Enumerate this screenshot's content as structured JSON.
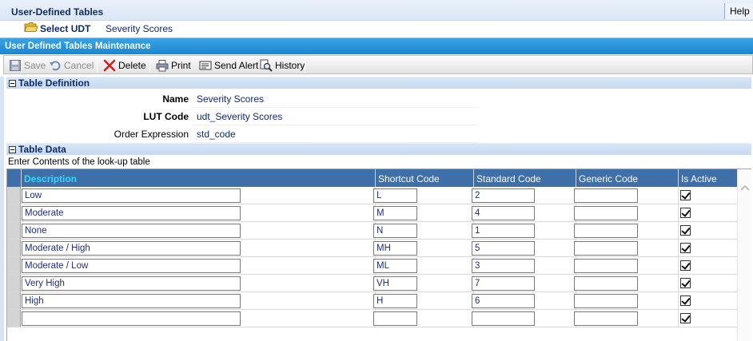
{
  "app": {
    "title": "User-Defined Tables",
    "help_label": "Help"
  },
  "select_bar": {
    "label": "Select UDT",
    "value": "Severity Scores"
  },
  "maintenance": {
    "title": "User Defined Tables Maintenance"
  },
  "toolbar": {
    "save": "Save",
    "cancel": "Cancel",
    "delete": "Delete",
    "print": "Print",
    "send_alert": "Send Alert",
    "history": "History"
  },
  "definition": {
    "section_title": "Table Definition",
    "name_label": "Name",
    "name_value": "Severity Scores",
    "lut_code_label": "LUT Code",
    "lut_code_value": "udt_Severity Scores",
    "order_expr_label": "Order Expression",
    "order_expr_value": "std_code"
  },
  "data": {
    "section_title": "Table Data",
    "instructions": "Enter Contents of the look-up table",
    "columns": [
      "Description",
      "Shortcut Code",
      "Standard Code",
      "Generic Code",
      "Is Active"
    ],
    "rows": [
      {
        "description": "Low",
        "shortcut": "L",
        "standard": "2",
        "generic": "",
        "active": true
      },
      {
        "description": "Moderate",
        "shortcut": "M",
        "standard": "4",
        "generic": "",
        "active": true
      },
      {
        "description": "None",
        "shortcut": "N",
        "standard": "1",
        "generic": "",
        "active": true
      },
      {
        "description": "Moderate / High",
        "shortcut": "MH",
        "standard": "5",
        "generic": "",
        "active": true
      },
      {
        "description": "Moderate / Low",
        "shortcut": "ML",
        "standard": "3",
        "generic": "",
        "active": true
      },
      {
        "description": "Very High",
        "shortcut": "VH",
        "standard": "7",
        "generic": "",
        "active": true
      },
      {
        "description": "High",
        "shortcut": "H",
        "standard": "6",
        "generic": "",
        "active": true
      },
      {
        "description": "",
        "shortcut": "",
        "standard": "",
        "generic": "",
        "active": true
      }
    ]
  },
  "colors": {
    "header_blue": "#1a86cf",
    "grid_header": "#3f6fa8",
    "active_header_text": "#36d7ff",
    "section_bg": "#c7d9f1",
    "value_text": "#0e2a6b"
  }
}
